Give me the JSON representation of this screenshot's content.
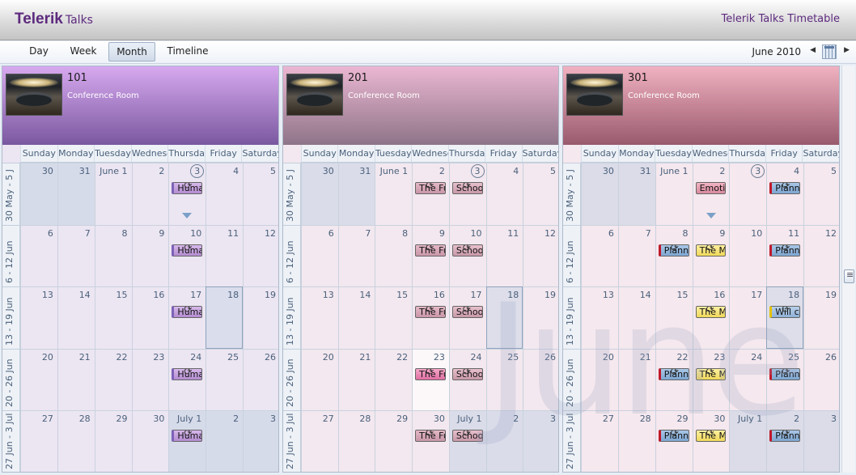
{
  "header": {
    "brand_main": "Telerik",
    "brand_sub": "Talks",
    "app_title": "Telerik Talks Timetable"
  },
  "toolbar": {
    "views": [
      {
        "label": "Day",
        "selected": false
      },
      {
        "label": "Week",
        "selected": false
      },
      {
        "label": "Month",
        "selected": true
      },
      {
        "label": "Timeline",
        "selected": false
      }
    ],
    "current_period": "June 2010",
    "prev_icon": "triangle-left-icon",
    "next_icon": "triangle-right-icon",
    "calendar_icon": "calendar-icon"
  },
  "watermark": "June",
  "day_names": [
    "Sunday",
    "Monday",
    "Tuesday",
    "Wednesday",
    "Thursday",
    "Friday",
    "Saturday"
  ],
  "weeks": [
    {
      "label": "30 May - 5 J",
      "days": [
        "30",
        "31",
        "June  1",
        "2",
        "3",
        "4",
        "5"
      ]
    },
    {
      "label": "6 - 12 Jun",
      "days": [
        "6",
        "7",
        "8",
        "9",
        "10",
        "11",
        "12"
      ]
    },
    {
      "label": "13 - 19 Jun",
      "days": [
        "13",
        "14",
        "15",
        "16",
        "17",
        "18",
        "19"
      ]
    },
    {
      "label": "20 - 26 Jun",
      "days": [
        "20",
        "21",
        "22",
        "23",
        "24",
        "25",
        "26"
      ]
    },
    {
      "label": "27 Jun - 3 Jul",
      "days": [
        "27",
        "28",
        "29",
        "30",
        "July  1",
        "2",
        "3"
      ]
    }
  ],
  "resources": [
    {
      "name": "101",
      "description": "Conference Room",
      "colors": {
        "top": "#d7a9ef",
        "bottom": "#7a58a0",
        "body": "#ece6f2"
      },
      "appointments": [
        {
          "week": 0,
          "day": 4,
          "subject": "Human",
          "style": "human",
          "recurring": true,
          "more": true
        },
        {
          "week": 1,
          "day": 4,
          "subject": "Human",
          "style": "human",
          "recurring": true
        },
        {
          "week": 2,
          "day": 4,
          "subject": "Human",
          "style": "human",
          "recurring": true
        },
        {
          "week": 3,
          "day": 4,
          "subject": "Human",
          "style": "human",
          "recurring": true
        },
        {
          "week": 4,
          "day": 4,
          "subject": "Human",
          "style": "human",
          "recurring": true
        }
      ]
    },
    {
      "name": "201",
      "description": "Conference Room",
      "colors": {
        "top": "#ebb7d2",
        "bottom": "#8e7488",
        "body": "#f3e8ef"
      },
      "appointments": [
        {
          "week": 0,
          "day": 3,
          "subject": "The Fu",
          "style": "thef",
          "recurring": true
        },
        {
          "week": 0,
          "day": 4,
          "subject": "Schoo",
          "style": "school",
          "recurring": true
        },
        {
          "week": 1,
          "day": 3,
          "subject": "The Fu",
          "style": "thef",
          "recurring": true
        },
        {
          "week": 1,
          "day": 4,
          "subject": "Schoo",
          "style": "school",
          "recurring": true
        },
        {
          "week": 2,
          "day": 3,
          "subject": "The Fu",
          "style": "thef",
          "recurring": true
        },
        {
          "week": 2,
          "day": 4,
          "subject": "Schoo",
          "style": "school",
          "recurring": true
        },
        {
          "week": 3,
          "day": 3,
          "subject": "The Fu",
          "style": "thef-hi",
          "recurring": true
        },
        {
          "week": 3,
          "day": 4,
          "subject": "Schoo",
          "style": "school",
          "recurring": true
        },
        {
          "week": 4,
          "day": 3,
          "subject": "The Fu",
          "style": "thef",
          "recurring": true
        },
        {
          "week": 4,
          "day": 4,
          "subject": "Schoo",
          "style": "school",
          "recurring": true
        }
      ]
    },
    {
      "name": "301",
      "description": "Conference Room",
      "colors": {
        "top": "#f0b1c0",
        "bottom": "#9a5a6e",
        "body": "#f5e8ee"
      },
      "appointments": [
        {
          "week": 0,
          "day": 3,
          "subject": "Emotio",
          "style": "emot",
          "recurring": false,
          "more": true
        },
        {
          "week": 0,
          "day": 5,
          "subject": "Planni",
          "style": "plan",
          "recurring": true
        },
        {
          "week": 1,
          "day": 2,
          "subject": "Plannii",
          "style": "plan",
          "recurring": true
        },
        {
          "week": 1,
          "day": 3,
          "subject": "The M",
          "style": "them",
          "recurring": true
        },
        {
          "week": 1,
          "day": 5,
          "subject": "Planni",
          "style": "plan",
          "recurring": true
        },
        {
          "week": 2,
          "day": 3,
          "subject": "The M",
          "style": "them",
          "recurring": true
        },
        {
          "week": 2,
          "day": 5,
          "subject": "Will ca",
          "style": "will",
          "recurring": true
        },
        {
          "week": 3,
          "day": 2,
          "subject": "Plannii",
          "style": "plan",
          "recurring": true
        },
        {
          "week": 3,
          "day": 3,
          "subject": "The M",
          "style": "them",
          "recurring": true
        },
        {
          "week": 3,
          "day": 5,
          "subject": "Planni",
          "style": "plan",
          "recurring": true
        },
        {
          "week": 4,
          "day": 2,
          "subject": "Plannii",
          "style": "plan",
          "recurring": true
        },
        {
          "week": 4,
          "day": 3,
          "subject": "The M",
          "style": "them",
          "recurring": true
        },
        {
          "week": 4,
          "day": 5,
          "subject": "Planni",
          "style": "plan",
          "recurring": true
        }
      ]
    }
  ]
}
